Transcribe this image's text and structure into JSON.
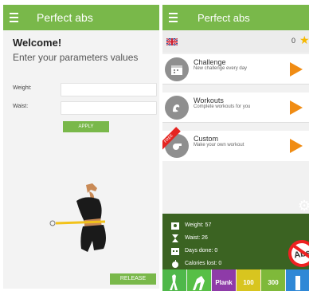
{
  "left": {
    "app_title": "Perfect abs",
    "welcome": "Welcome!",
    "prompt": "Enter your parameters values",
    "weight_label": "Weight:",
    "waist_label": "Waist:",
    "apply_label": "APPLY",
    "release_label": "RELEASE"
  },
  "right": {
    "app_title": "Perfect abs",
    "points": "0",
    "cards": [
      {
        "title": "Challenge",
        "subtitle": "New challenge every day"
      },
      {
        "title": "Workouts",
        "subtitle": "Complete workouts for you"
      },
      {
        "title": "Custom",
        "subtitle": "Make your own workout",
        "badge": "FREE"
      }
    ],
    "stats": [
      {
        "label": "Weight: 57"
      },
      {
        "label": "Waist: 26"
      },
      {
        "label": "Days done: 0"
      },
      {
        "label": "Calories lost: 0"
      }
    ],
    "no_abs_text": "Abs",
    "tiles": [
      "",
      "",
      "Plank",
      "100",
      "300",
      ""
    ]
  },
  "colors": {
    "primary_green": "#79b84a",
    "dark_green": "#3b6322",
    "orange": "#f08c14",
    "star": "#f5b800"
  }
}
